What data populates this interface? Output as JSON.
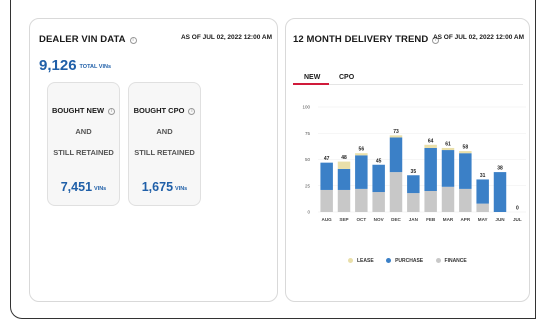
{
  "dealer": {
    "title": "DEALER VIN DATA",
    "as_of": "AS OF JUL 02, 2022 12:00 AM",
    "total_value": "9,126",
    "total_label": "TOTAL VINs",
    "new_box": {
      "line1": "BOUGHT NEW",
      "line2": "AND",
      "line3": "STILL RETAINED",
      "value": "7,451",
      "unit": "VINs"
    },
    "cpo_box": {
      "line1": "BOUGHT CPO",
      "line2": "AND",
      "line3": "STILL RETAINED",
      "value": "1,675",
      "unit": "VINs"
    }
  },
  "trend": {
    "title": "12 MONTH DELIVERY TREND",
    "as_of": "AS OF JUL 02, 2022 12:00 AM",
    "tabs": [
      "NEW",
      "CPO"
    ],
    "active_tab": "NEW"
  },
  "colors": {
    "lease": "#e9dfaa",
    "purchase": "#3b80c7",
    "finance": "#c8c8c8",
    "accent": "#d01a3a",
    "brand_blue": "#1f5fa8"
  },
  "chart_data": {
    "type": "bar",
    "stacked": true,
    "categories": [
      "AUG",
      "SEP",
      "OCT",
      "NOV",
      "DEC",
      "JAN",
      "FEB",
      "MAR",
      "APR",
      "MAY",
      "JUN",
      "JUL"
    ],
    "series": [
      {
        "name": "FINANCE",
        "values": [
          21,
          21,
          22,
          19,
          38,
          18,
          20,
          24,
          22,
          8,
          0,
          0
        ]
      },
      {
        "name": "PURCHASE",
        "values": [
          26,
          20,
          32,
          26,
          33,
          17,
          41,
          35,
          34,
          23,
          38,
          0
        ]
      },
      {
        "name": "LEASE",
        "values": [
          0,
          7,
          2,
          0,
          2,
          0,
          3,
          2,
          2,
          0,
          0,
          0
        ]
      }
    ],
    "totals": [
      47,
      48,
      56,
      45,
      73,
      35,
      64,
      61,
      58,
      31,
      38,
      0
    ],
    "yticks": [
      0,
      25,
      50,
      75,
      100
    ],
    "ylim": [
      0,
      100
    ],
    "legend": [
      "LEASE",
      "PURCHASE",
      "FINANCE"
    ],
    "legend_position": "bottom",
    "grid": true
  }
}
